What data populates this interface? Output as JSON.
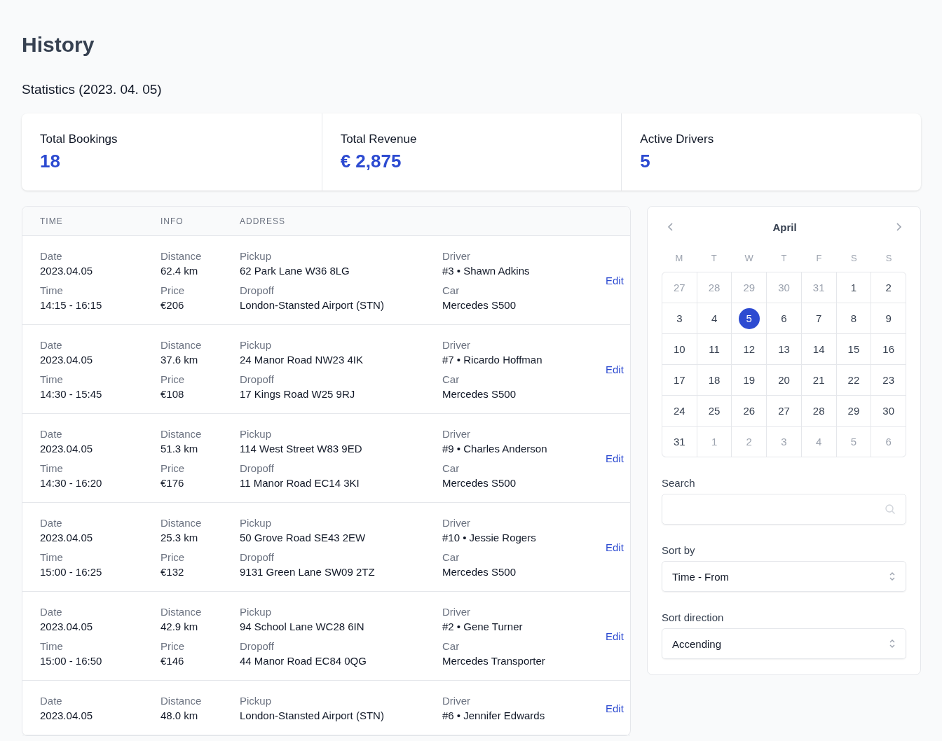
{
  "page": {
    "title": "History"
  },
  "statistics": {
    "heading": "Statistics (2023. 04. 05)",
    "cards": [
      {
        "label": "Total Bookings",
        "value": "18"
      },
      {
        "label": "Total Revenue",
        "value": "€ 2,875"
      },
      {
        "label": "Active Drivers",
        "value": "5"
      }
    ]
  },
  "table": {
    "columns": [
      "TIME",
      "INFO",
      "ADDRESS"
    ],
    "rows": [
      {
        "time": [
          {
            "label": "Date",
            "value": "2023.04.05"
          },
          {
            "label": "Time",
            "value": "14:15 - 16:15"
          }
        ],
        "info": [
          {
            "label": "Distance",
            "value": "62.4 km"
          },
          {
            "label": "Price",
            "value": "€206"
          }
        ],
        "address": [
          {
            "label": "Pickup",
            "value": "62 Park Lane W36 8LG"
          },
          {
            "label": "Dropoff",
            "value": "London-Stansted Airport (STN)"
          }
        ],
        "driver": [
          {
            "label": "Driver",
            "value": "#3 • Shawn Adkins"
          },
          {
            "label": "Car",
            "value": "Mercedes S500"
          }
        ],
        "edit": "Edit"
      },
      {
        "time": [
          {
            "label": "Date",
            "value": "2023.04.05"
          },
          {
            "label": "Time",
            "value": "14:30 - 15:45"
          }
        ],
        "info": [
          {
            "label": "Distance",
            "value": "37.6 km"
          },
          {
            "label": "Price",
            "value": "€108"
          }
        ],
        "address": [
          {
            "label": "Pickup",
            "value": "24 Manor Road NW23 4IK"
          },
          {
            "label": "Dropoff",
            "value": "17 Kings Road W25 9RJ"
          }
        ],
        "driver": [
          {
            "label": "Driver",
            "value": "#7 • Ricardo Hoffman"
          },
          {
            "label": "Car",
            "value": "Mercedes S500"
          }
        ],
        "edit": "Edit"
      },
      {
        "time": [
          {
            "label": "Date",
            "value": "2023.04.05"
          },
          {
            "label": "Time",
            "value": "14:30 - 16:20"
          }
        ],
        "info": [
          {
            "label": "Distance",
            "value": "51.3 km"
          },
          {
            "label": "Price",
            "value": "€176"
          }
        ],
        "address": [
          {
            "label": "Pickup",
            "value": "114 West Street W83 9ED"
          },
          {
            "label": "Dropoff",
            "value": "11 Manor Road EC14 3KI"
          }
        ],
        "driver": [
          {
            "label": "Driver",
            "value": "#9 • Charles Anderson"
          },
          {
            "label": "Car",
            "value": "Mercedes S500"
          }
        ],
        "edit": "Edit"
      },
      {
        "time": [
          {
            "label": "Date",
            "value": "2023.04.05"
          },
          {
            "label": "Time",
            "value": "15:00 - 16:25"
          }
        ],
        "info": [
          {
            "label": "Distance",
            "value": "25.3 km"
          },
          {
            "label": "Price",
            "value": "€132"
          }
        ],
        "address": [
          {
            "label": "Pickup",
            "value": "50 Grove Road SE43 2EW"
          },
          {
            "label": "Dropoff",
            "value": "9131 Green Lane SW09 2TZ"
          }
        ],
        "driver": [
          {
            "label": "Driver",
            "value": "#10 • Jessie Rogers"
          },
          {
            "label": "Car",
            "value": "Mercedes S500"
          }
        ],
        "edit": "Edit"
      },
      {
        "time": [
          {
            "label": "Date",
            "value": "2023.04.05"
          },
          {
            "label": "Time",
            "value": "15:00 - 16:50"
          }
        ],
        "info": [
          {
            "label": "Distance",
            "value": "42.9 km"
          },
          {
            "label": "Price",
            "value": "€146"
          }
        ],
        "address": [
          {
            "label": "Pickup",
            "value": "94 School Lane WC28 6IN"
          },
          {
            "label": "Dropoff",
            "value": "44 Manor Road EC84 0QG"
          }
        ],
        "driver": [
          {
            "label": "Driver",
            "value": "#2 • Gene Turner"
          },
          {
            "label": "Car",
            "value": "Mercedes Transporter"
          }
        ],
        "edit": "Edit"
      },
      {
        "time": [
          {
            "label": "Date",
            "value": "2023.04.05"
          }
        ],
        "info": [
          {
            "label": "Distance",
            "value": "48.0 km"
          }
        ],
        "address": [
          {
            "label": "Pickup",
            "value": "London-Stansted Airport (STN)"
          }
        ],
        "driver": [
          {
            "label": "Driver",
            "value": "#6 • Jennifer Edwards"
          }
        ],
        "edit": "Edit"
      }
    ]
  },
  "calendar": {
    "month": "April",
    "weekdays": [
      "M",
      "T",
      "W",
      "T",
      "F",
      "S",
      "S"
    ],
    "days": [
      {
        "label": "27",
        "muted": true,
        "selected": false
      },
      {
        "label": "28",
        "muted": true,
        "selected": false
      },
      {
        "label": "29",
        "muted": true,
        "selected": false
      },
      {
        "label": "30",
        "muted": true,
        "selected": false
      },
      {
        "label": "31",
        "muted": true,
        "selected": false
      },
      {
        "label": "1",
        "muted": false,
        "selected": false
      },
      {
        "label": "2",
        "muted": false,
        "selected": false
      },
      {
        "label": "3",
        "muted": false,
        "selected": false
      },
      {
        "label": "4",
        "muted": false,
        "selected": false
      },
      {
        "label": "5",
        "muted": false,
        "selected": true
      },
      {
        "label": "6",
        "muted": false,
        "selected": false
      },
      {
        "label": "7",
        "muted": false,
        "selected": false
      },
      {
        "label": "8",
        "muted": false,
        "selected": false
      },
      {
        "label": "9",
        "muted": false,
        "selected": false
      },
      {
        "label": "10",
        "muted": false,
        "selected": false
      },
      {
        "label": "11",
        "muted": false,
        "selected": false
      },
      {
        "label": "12",
        "muted": false,
        "selected": false
      },
      {
        "label": "13",
        "muted": false,
        "selected": false
      },
      {
        "label": "14",
        "muted": false,
        "selected": false
      },
      {
        "label": "15",
        "muted": false,
        "selected": false
      },
      {
        "label": "16",
        "muted": false,
        "selected": false
      },
      {
        "label": "17",
        "muted": false,
        "selected": false
      },
      {
        "label": "18",
        "muted": false,
        "selected": false
      },
      {
        "label": "19",
        "muted": false,
        "selected": false
      },
      {
        "label": "20",
        "muted": false,
        "selected": false
      },
      {
        "label": "21",
        "muted": false,
        "selected": false
      },
      {
        "label": "22",
        "muted": false,
        "selected": false
      },
      {
        "label": "23",
        "muted": false,
        "selected": false
      },
      {
        "label": "24",
        "muted": false,
        "selected": false
      },
      {
        "label": "25",
        "muted": false,
        "selected": false
      },
      {
        "label": "26",
        "muted": false,
        "selected": false
      },
      {
        "label": "27",
        "muted": false,
        "selected": false
      },
      {
        "label": "28",
        "muted": false,
        "selected": false
      },
      {
        "label": "29",
        "muted": false,
        "selected": false
      },
      {
        "label": "30",
        "muted": false,
        "selected": false
      },
      {
        "label": "31",
        "muted": false,
        "selected": false
      },
      {
        "label": "1",
        "muted": true,
        "selected": false
      },
      {
        "label": "2",
        "muted": true,
        "selected": false
      },
      {
        "label": "3",
        "muted": true,
        "selected": false
      },
      {
        "label": "4",
        "muted": true,
        "selected": false
      },
      {
        "label": "5",
        "muted": true,
        "selected": false
      },
      {
        "label": "6",
        "muted": true,
        "selected": false
      }
    ]
  },
  "filters": {
    "search": {
      "label": "Search"
    },
    "sort_by": {
      "label": "Sort by",
      "value": "Time - From"
    },
    "sort_direction": {
      "label": "Sort direction",
      "value": "Accending"
    }
  }
}
